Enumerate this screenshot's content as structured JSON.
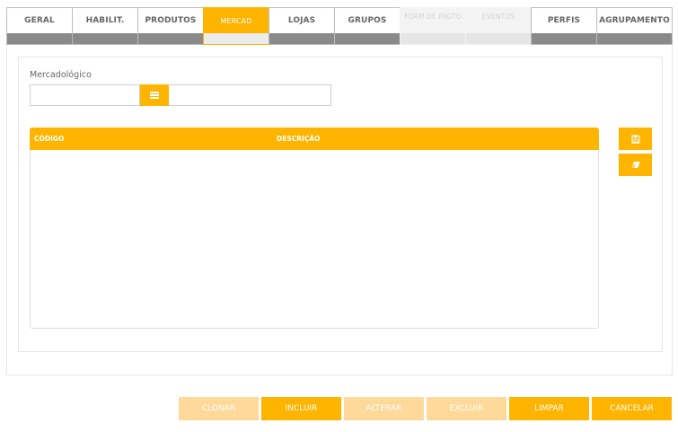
{
  "tabs": [
    {
      "label": "GERAL",
      "state": "normal"
    },
    {
      "label": "HABILIT.",
      "state": "normal"
    },
    {
      "label": "PRODUTOS",
      "state": "normal"
    },
    {
      "label": "MERCAD",
      "state": "active"
    },
    {
      "label": "LOJAS",
      "state": "normal"
    },
    {
      "label": "GRUPOS",
      "state": "normal"
    },
    {
      "label": "FORM DE PAGTO",
      "state": "disabled"
    },
    {
      "label": "EVENTOS",
      "state": "disabled"
    },
    {
      "label": "PERFIS",
      "state": "normal"
    },
    {
      "label": "AGRUPAMENTO",
      "state": "normal"
    }
  ],
  "form": {
    "label": "Mercadológico",
    "code_value": "",
    "description_value": ""
  },
  "grid": {
    "columns": [
      "CÓDIGO",
      "DESCRIÇÃO"
    ],
    "rows": []
  },
  "side_actions": {
    "save_icon": "floppy-disk-icon",
    "clear_icon": "eraser-icon"
  },
  "footer": {
    "buttons": [
      {
        "label": "CLONAR",
        "enabled": false
      },
      {
        "label": "INCLUIR",
        "enabled": true
      },
      {
        "label": "ALTERAR",
        "enabled": false
      },
      {
        "label": "EXCLUIR",
        "enabled": false
      },
      {
        "label": "LIMPAR",
        "enabled": true
      },
      {
        "label": "CANCELAR",
        "enabled": true
      }
    ]
  },
  "colors": {
    "accent": "#FFB400",
    "accent_disabled": "#FFD999",
    "tab_strip": "#8A8A8A"
  }
}
